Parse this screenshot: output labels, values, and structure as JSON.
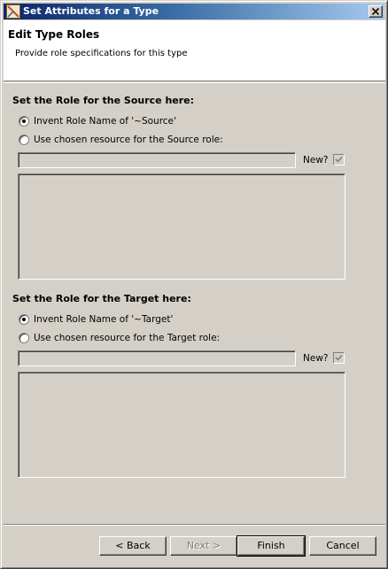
{
  "window": {
    "title": "Set Attributes for a Type"
  },
  "banner": {
    "title": "Edit Type Roles",
    "description": "Provide role specifications for this type"
  },
  "source": {
    "heading": "Set the Role for the Source here:",
    "invent_label": "Invent Role Name of '~Source'",
    "chosen_label": "Use chosen resource for the Source role:",
    "selected": "invent",
    "field_value": "",
    "new_label": "New?",
    "new_checked": true
  },
  "target": {
    "heading": "Set the Role for the Target here:",
    "invent_label": "Invent Role Name of '~Target'",
    "chosen_label": "Use chosen resource for the Target role:",
    "selected": "invent",
    "field_value": "",
    "new_label": "New?",
    "new_checked": true
  },
  "buttons": {
    "back": "< Back",
    "next": "Next >",
    "finish": "Finish",
    "cancel": "Cancel"
  }
}
